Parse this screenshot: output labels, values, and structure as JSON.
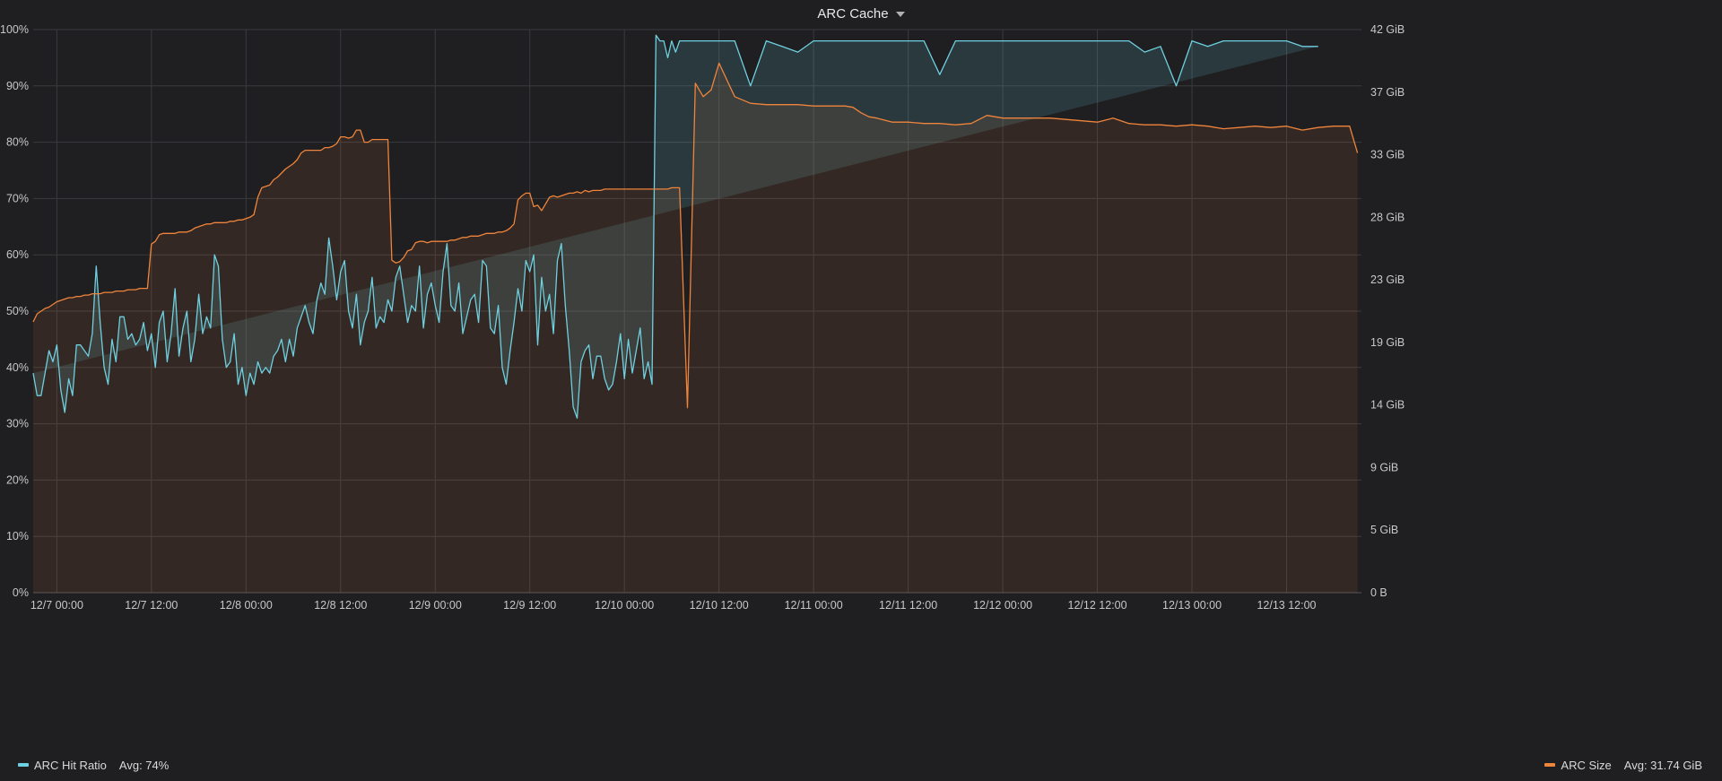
{
  "panel": {
    "title": "ARC Cache"
  },
  "chart_data": {
    "type": "line",
    "title": "ARC Cache",
    "grid": true,
    "legend_placement": "bottom",
    "x_ticks": [
      "12/7 00:00",
      "12/7 12:00",
      "12/8 00:00",
      "12/8 12:00",
      "12/9 00:00",
      "12/9 12:00",
      "12/10 00:00",
      "12/10 12:00",
      "12/11 00:00",
      "12/11 12:00",
      "12/12 00:00",
      "12/12 12:00",
      "12/13 00:00",
      "12/13 12:00"
    ],
    "y_left": {
      "ticks": [
        "0%",
        "10%",
        "20%",
        "30%",
        "40%",
        "50%",
        "60%",
        "70%",
        "80%",
        "90%",
        "100%"
      ],
      "range": [
        0,
        100
      ],
      "unit": "%"
    },
    "y_right": {
      "ticks": [
        "0 B",
        "5 GiB",
        "9 GiB",
        "14 GiB",
        "19 GiB",
        "23 GiB",
        "28 GiB",
        "33 GiB",
        "37 GiB",
        "42 GiB"
      ],
      "range": [
        0,
        42
      ],
      "unit": "GiB"
    },
    "x_range_hours": [
      -3.0,
      165.5
    ],
    "series": [
      {
        "name": "ARC Hit Ratio",
        "axis": "left",
        "color": "#6ed0e0",
        "legend": {
          "label": "ARC Hit Ratio",
          "avg": "Avg: 74%"
        },
        "x_hours": [
          -3.0,
          -2.5,
          -2.0,
          -1.5,
          -1.0,
          -0.5,
          0.0,
          0.5,
          1.0,
          1.5,
          2.0,
          2.5,
          3.0,
          3.5,
          4.0,
          4.5,
          5.0,
          5.5,
          6.0,
          6.5,
          7.0,
          7.5,
          8.0,
          8.5,
          9.0,
          9.5,
          10.0,
          10.5,
          11.0,
          11.5,
          12.0,
          12.5,
          13.0,
          13.5,
          14.0,
          14.5,
          15.0,
          15.5,
          16.0,
          16.5,
          17.0,
          17.5,
          18.0,
          18.5,
          19.0,
          19.5,
          20.0,
          20.5,
          21.0,
          21.5,
          22.0,
          22.5,
          23.0,
          23.5,
          24.0,
          24.5,
          25.0,
          25.5,
          26.0,
          26.5,
          27.0,
          27.5,
          28.0,
          28.5,
          29.0,
          29.5,
          30.0,
          30.5,
          31.0,
          31.5,
          32.0,
          32.5,
          33.0,
          33.5,
          34.0,
          34.5,
          35.0,
          35.5,
          36.0,
          36.5,
          37.0,
          37.5,
          38.0,
          38.5,
          39.0,
          39.5,
          40.0,
          40.5,
          41.0,
          41.5,
          42.0,
          42.5,
          43.0,
          43.5,
          44.0,
          44.5,
          45.0,
          45.5,
          46.0,
          46.5,
          47.0,
          47.5,
          48.0,
          48.5,
          49.0,
          49.5,
          50.0,
          50.5,
          51.0,
          51.5,
          52.0,
          52.5,
          53.0,
          53.5,
          54.0,
          54.5,
          55.0,
          55.5,
          56.0,
          56.5,
          57.0,
          57.5,
          58.0,
          58.5,
          59.0,
          59.5,
          60.0,
          60.5,
          61.0,
          61.5,
          62.0,
          62.5,
          63.0,
          63.5,
          64.0,
          64.5,
          65.0,
          65.5,
          66.0,
          66.5,
          67.0,
          67.5,
          68.0,
          68.5,
          69.0,
          69.5,
          70.0,
          70.5,
          71.0,
          71.5,
          72.0,
          72.5,
          73.0,
          73.5,
          74.0,
          74.5,
          75.0,
          75.5,
          76.0,
          76.5,
          77.0,
          77.5,
          78.0,
          78.5,
          79.0,
          80,
          81,
          82,
          83,
          84,
          86,
          88,
          90,
          92,
          94,
          96,
          98,
          100,
          101,
          102,
          103,
          104,
          106,
          108,
          110,
          112,
          114,
          116,
          118,
          120,
          121,
          122,
          123,
          124,
          126,
          128,
          130,
          132,
          134,
          136,
          138,
          140,
          142,
          144,
          146,
          148,
          150,
          152,
          154,
          156,
          158,
          160,
          162,
          164,
          165
        ],
        "values": [
          39,
          35,
          35,
          39,
          43,
          41,
          44,
          36,
          32,
          38,
          35,
          44,
          44,
          43,
          42,
          46,
          58,
          48,
          40,
          37,
          45,
          41,
          49,
          49,
          45,
          46,
          44,
          45,
          48,
          43,
          46,
          40,
          48,
          50,
          41,
          46,
          54,
          42,
          47,
          50,
          41,
          45,
          53,
          46,
          49,
          47,
          60,
          58,
          45,
          40,
          41,
          46,
          37,
          40,
          35,
          39,
          37,
          41,
          39,
          40,
          39,
          42,
          43,
          45,
          41,
          45,
          42,
          47,
          49,
          51,
          48,
          46,
          52,
          55,
          53,
          63,
          58,
          52,
          57,
          59,
          50,
          47,
          53,
          44,
          48,
          50,
          56,
          47,
          49,
          48,
          52,
          50,
          56,
          58,
          53,
          48,
          51,
          50,
          58,
          47,
          53,
          55,
          51,
          48,
          57,
          62,
          51,
          50,
          55,
          46,
          49,
          52,
          53,
          48,
          59,
          58,
          47,
          46,
          51,
          40,
          37,
          43,
          48,
          54,
          50,
          59,
          57,
          60,
          44,
          56,
          50,
          53,
          46,
          59,
          62,
          51,
          43,
          33,
          31,
          41,
          43,
          44,
          38,
          42,
          42,
          38,
          36,
          37,
          41,
          46,
          38,
          45,
          39,
          43,
          47,
          38,
          41,
          37,
          99,
          98,
          98,
          95,
          98,
          96,
          98,
          98,
          98,
          98,
          98,
          98,
          98,
          90,
          98,
          97,
          96,
          98,
          98,
          98,
          98,
          98,
          98,
          98,
          98,
          98,
          98,
          92,
          98,
          98,
          98,
          98,
          98,
          98,
          98,
          98,
          98,
          98,
          98,
          98,
          98,
          98,
          96,
          97,
          90,
          98,
          97,
          98,
          98,
          98,
          98,
          98,
          97,
          97
        ]
      },
      {
        "name": "ARC Size",
        "axis": "right",
        "color": "#ef843c",
        "legend": {
          "label": "ARC Size",
          "avg": "Avg: 31.74 GiB"
        },
        "x_hours": [
          -3.0,
          -2.5,
          -2.0,
          -1.5,
          -1.0,
          -0.5,
          0.0,
          0.5,
          1.0,
          1.5,
          2.0,
          2.5,
          3.0,
          3.5,
          4.0,
          4.5,
          5.0,
          5.5,
          6.0,
          6.5,
          7.0,
          7.5,
          8.0,
          8.5,
          9.0,
          9.5,
          10.0,
          10.5,
          11.0,
          11.5,
          12.0,
          12.5,
          13.0,
          13.5,
          14.0,
          14.5,
          15.0,
          15.5,
          16.0,
          16.5,
          17.0,
          17.5,
          18.0,
          18.5,
          19.0,
          19.5,
          20.0,
          20.5,
          21.0,
          21.5,
          22.0,
          22.5,
          23.0,
          23.5,
          24.0,
          24.5,
          25.0,
          25.5,
          26.0,
          26.5,
          27.0,
          27.5,
          28.0,
          28.5,
          29.0,
          29.5,
          30.0,
          30.5,
          31.0,
          31.5,
          32.0,
          32.5,
          33.0,
          33.5,
          34.0,
          34.5,
          35.0,
          35.5,
          36.0,
          36.5,
          37.0,
          37.5,
          38.0,
          38.5,
          39.0,
          39.5,
          40.0,
          40.5,
          41.0,
          41.5,
          42.0,
          42.5,
          43.0,
          43.5,
          44.0,
          44.5,
          45.0,
          45.5,
          46.0,
          46.5,
          47.0,
          47.5,
          48.0,
          48.5,
          49.0,
          49.5,
          50.0,
          50.5,
          51.0,
          51.5,
          52.0,
          52.5,
          53.0,
          53.5,
          54.0,
          54.5,
          55.0,
          55.5,
          56.0,
          56.5,
          57.0,
          57.5,
          58.0,
          58.5,
          59.0,
          59.5,
          60.0,
          60.5,
          61.0,
          61.5,
          62.0,
          62.5,
          63.0,
          63.5,
          64.0,
          64.5,
          65.0,
          65.5,
          66.0,
          66.5,
          67.0,
          67.5,
          68.0,
          68.5,
          69.0,
          69.5,
          70.0,
          70.5,
          71.0,
          71.5,
          72.0,
          72.5,
          73.0,
          73.5,
          74.0,
          74.5,
          75.0,
          75.5,
          76.0,
          76.5,
          77.0,
          77.5,
          78.0,
          78.5,
          79.0,
          80,
          81,
          82,
          83,
          84,
          86,
          88,
          90,
          92,
          94,
          96,
          98,
          100,
          101,
          102,
          103,
          104,
          106,
          108,
          110,
          112,
          114,
          116,
          118,
          120,
          121,
          122,
          123,
          124,
          126,
          128,
          130,
          132,
          134,
          136,
          138,
          140,
          142,
          144,
          146,
          148,
          150,
          152,
          154,
          156,
          158,
          160,
          162,
          164,
          165
        ],
        "values": [
          20.2,
          20.8,
          21.0,
          21.2,
          21.3,
          21.5,
          21.7,
          21.8,
          21.9,
          22.0,
          22.0,
          22.1,
          22.1,
          22.2,
          22.2,
          22.3,
          22.3,
          22.3,
          22.4,
          22.4,
          22.4,
          22.5,
          22.5,
          22.5,
          22.6,
          22.6,
          22.6,
          22.7,
          22.7,
          22.7,
          26.0,
          26.2,
          26.7,
          26.8,
          26.8,
          26.8,
          26.8,
          26.9,
          26.9,
          26.9,
          27.0,
          27.2,
          27.3,
          27.4,
          27.5,
          27.5,
          27.6,
          27.6,
          27.6,
          27.6,
          27.7,
          27.7,
          27.8,
          27.8,
          27.9,
          28.0,
          28.2,
          29.5,
          30.2,
          30.3,
          30.4,
          30.8,
          31.0,
          31.3,
          31.6,
          31.8,
          32.0,
          32.3,
          32.8,
          33.0,
          33.0,
          33.0,
          33.0,
          33.0,
          33.2,
          33.2,
          33.3,
          33.5,
          34.0,
          34.0,
          33.9,
          34.0,
          34.5,
          34.5,
          33.6,
          33.6,
          33.8,
          33.8,
          33.8,
          33.8,
          33.8,
          24.8,
          24.6,
          24.7,
          25.0,
          25.5,
          25.6,
          26.1,
          26.2,
          26.2,
          26.1,
          26.2,
          26.2,
          26.2,
          26.2,
          26.2,
          26.3,
          26.3,
          26.4,
          26.5,
          26.5,
          26.6,
          26.6,
          26.6,
          26.7,
          26.8,
          26.8,
          26.8,
          26.9,
          26.9,
          27.0,
          27.2,
          27.5,
          29.3,
          29.6,
          29.8,
          29.8,
          28.8,
          28.9,
          28.5,
          29.0,
          29.5,
          29.6,
          29.5,
          29.6,
          29.7,
          29.8,
          29.8,
          29.9,
          29.8,
          30.0,
          29.9,
          30.0,
          30.0,
          30.0,
          30.1,
          30.1,
          30.1,
          30.1,
          30.1,
          30.1,
          30.1,
          30.1,
          30.1,
          30.1,
          30.1,
          30.1,
          30.1,
          30.1,
          30.1,
          30.1,
          30.1,
          30.2,
          30.2,
          30.2,
          13.8,
          38.0,
          37.0,
          37.5,
          39.5,
          37.0,
          36.5,
          36.4,
          36.4,
          36.4,
          36.3,
          36.3,
          36.3,
          36.2,
          35.8,
          35.5,
          35.4,
          35.1,
          35.1,
          35.0,
          35.0,
          34.9,
          35.0,
          35.6,
          35.4,
          35.4,
          35.4,
          35.4,
          35.4,
          35.4,
          35.3,
          35.2,
          35.1,
          35.4,
          35.0,
          34.9,
          34.9,
          34.8,
          34.9,
          34.8,
          34.6,
          34.7,
          34.8,
          34.7,
          34.8,
          34.5,
          34.7,
          34.8,
          34.8,
          32.8,
          34.6,
          34.6,
          34.6,
          34.6,
          34.6,
          34.6,
          34.6,
          34.6,
          34.6,
          34.6,
          34.2
        ]
      }
    ]
  }
}
